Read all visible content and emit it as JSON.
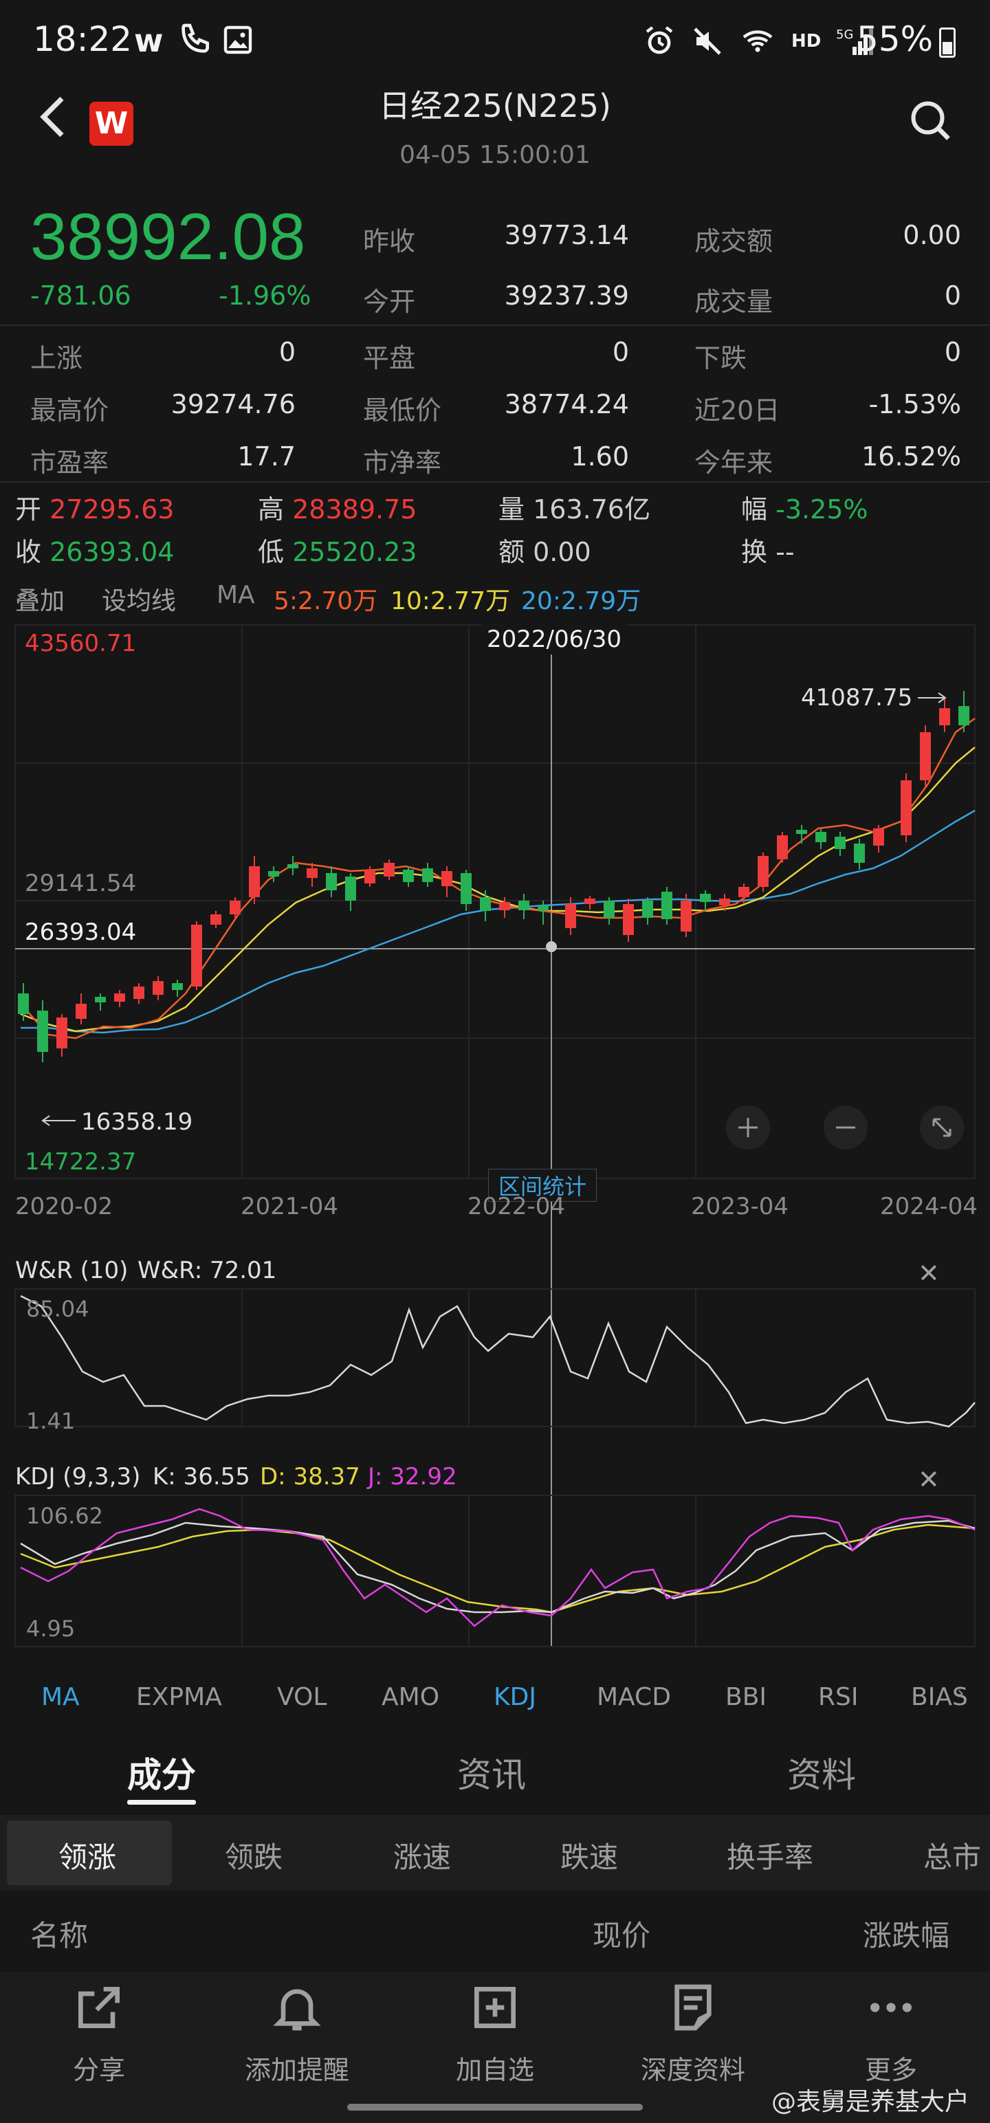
{
  "status": {
    "time": "18:22",
    "left_icons": [
      "w-icon",
      "phone-wifi-icon",
      "image-icon"
    ],
    "right_icons": [
      "alarm-icon",
      "mute-icon",
      "wifi-icon",
      "hd-icon",
      "signal-5g-icon"
    ],
    "battery": "55%"
  },
  "header": {
    "title": "日经225(N225)",
    "datetime": "04-05 15:00:01",
    "logo_text": "W"
  },
  "quote": {
    "price": "38992.08",
    "change": "-781.06",
    "change_pct": "-1.96%",
    "stats_top": [
      {
        "label": "昨收",
        "value": "39773.14"
      },
      {
        "label": "成交额",
        "value": "0.00"
      },
      {
        "label": "今开",
        "value": "39237.39"
      },
      {
        "label": "成交量",
        "value": "0"
      }
    ],
    "stats_grid": [
      {
        "label": "上涨",
        "value": "0"
      },
      {
        "label": "平盘",
        "value": "0"
      },
      {
        "label": "下跌",
        "value": "0"
      },
      {
        "label": "最高价",
        "value": "39274.76"
      },
      {
        "label": "最低价",
        "value": "38774.24"
      },
      {
        "label": "近20日",
        "value": "-1.53%"
      },
      {
        "label": "市盈率",
        "value": "17.7"
      },
      {
        "label": "市净率",
        "value": "1.60"
      },
      {
        "label": "今年来",
        "value": "16.52%"
      }
    ]
  },
  "ohlc": {
    "open_label": "开",
    "open": "27295.63",
    "high_label": "高",
    "high": "28389.75",
    "vol_label": "量",
    "vol": "163.76亿",
    "amp_label": "幅",
    "amp": "-3.25%",
    "close_label": "收",
    "close": "26393.04",
    "low_label": "低",
    "low": "25520.23",
    "amt_label": "额",
    "amt": "0.00",
    "turn_label": "换",
    "turn": "--"
  },
  "ma_bar": {
    "overlay": "叠加",
    "set_ma": "设均线",
    "ma": "MA",
    "ma5": "5:2.70万",
    "ma10": "10:2.77万",
    "ma20": "20:2.79万",
    "colors": {
      "ma5": "#f25c2a",
      "ma10": "#e6d63a",
      "ma20": "#3aa3e0"
    }
  },
  "main_chart": {
    "crosshair_date": "2022/06/30",
    "top_price": "43560.71",
    "mid_price": "29141.54",
    "cross_price": "26393.04",
    "bottom_price": "14722.37",
    "max_marker": "41087.75",
    "min_marker": "16358.19",
    "x_labels": [
      "2020-02",
      "2021-04",
      "2022-04",
      "2023-04",
      "2024-04"
    ],
    "range_stats": "区间统计"
  },
  "wr": {
    "title": "W&R (10)",
    "value": "W&R: 72.01",
    "top": "85.04",
    "bottom": "1.41"
  },
  "kdj": {
    "title": "KDJ (9,3,3)",
    "k": "K: 36.55",
    "d": "D: 38.37",
    "j": "J: 32.92",
    "top": "106.62",
    "bottom": "4.95"
  },
  "indicator_tabs": [
    "MA",
    "EXPMA",
    "VOL",
    "AMO",
    "KDJ",
    "MACD",
    "BBI",
    "RSI",
    "BIAS"
  ],
  "main_tabs": [
    "成分",
    "资讯",
    "资料"
  ],
  "filter_tabs": [
    "领涨",
    "领跌",
    "涨速",
    "跌速",
    "换手率",
    "总市"
  ],
  "list_header": {
    "name": "名称",
    "price": "现价",
    "change": "涨跌幅"
  },
  "bottom_bar": [
    {
      "label": "分享",
      "icon": "share-icon"
    },
    {
      "label": "添加提醒",
      "icon": "bell-icon"
    },
    {
      "label": "加自选",
      "icon": "add-box-icon"
    },
    {
      "label": "深度资料",
      "icon": "report-icon"
    },
    {
      "label": "更多",
      "icon": "more-icon"
    }
  ],
  "watermark": "@表舅是养基大户"
}
